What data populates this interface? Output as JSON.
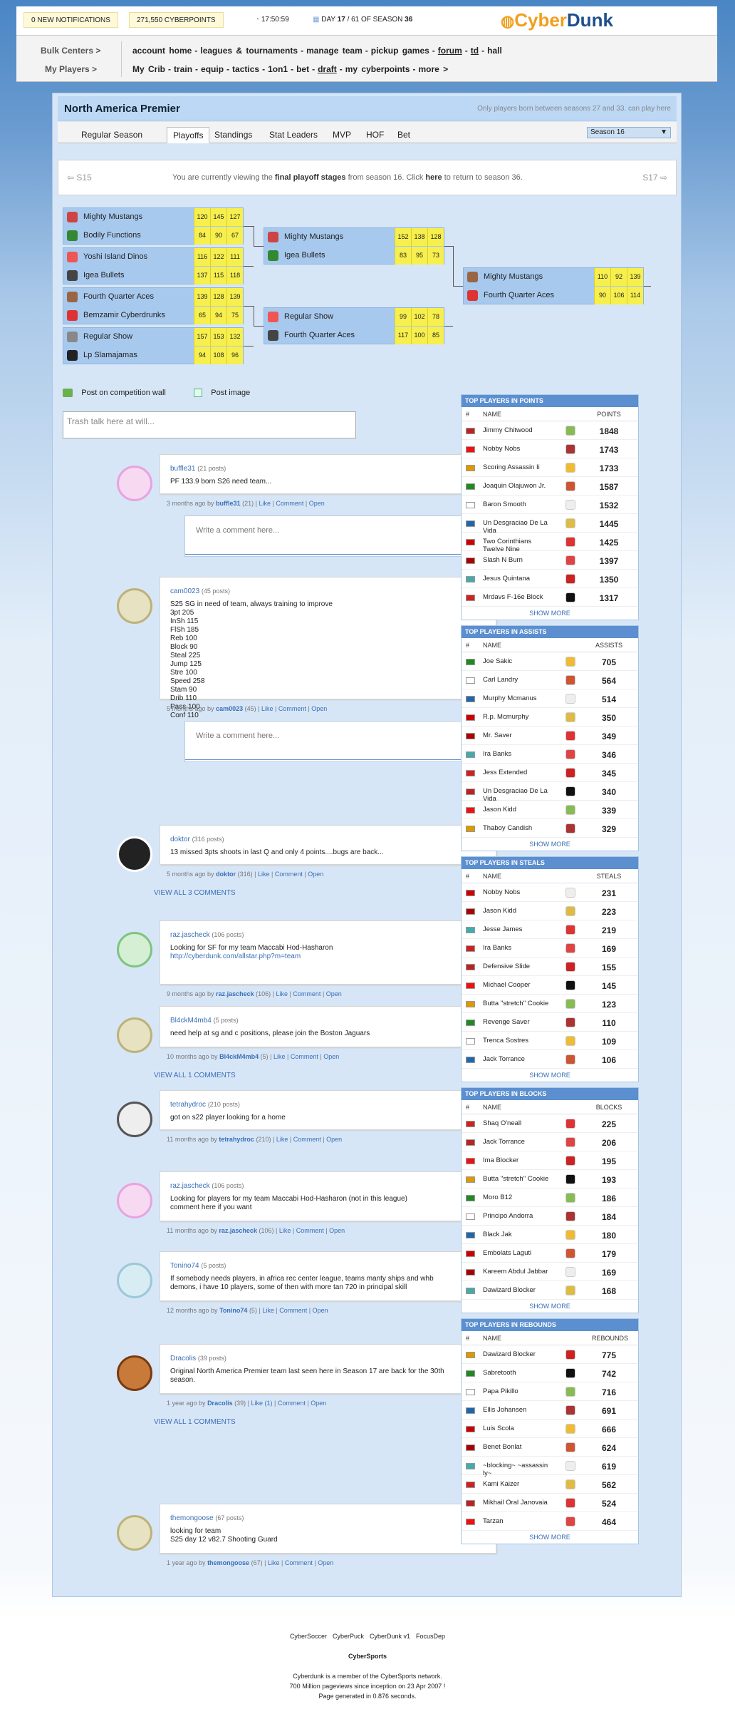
{
  "topbar": {
    "notifications": "0 NEW NOTIFICATIONS",
    "cyberpoints": "271,550 CYBERPOINTS",
    "time": "17:50:59",
    "season_prefix": "DAY",
    "day": "17",
    "day_of": "/ 61 OF SEASON",
    "season": "36",
    "logo_a": "Cyber",
    "logo_b": "Dunk"
  },
  "menu": {
    "left1": "Bulk Centers >",
    "left2": "My Players >",
    "row1": [
      "account home",
      "-",
      "leagues & tournaments",
      "-",
      "manage team",
      "-",
      "pickup games",
      "-",
      "forum",
      "-",
      "td",
      "-",
      "hall"
    ],
    "row2": [
      "My Crib",
      "-",
      "train",
      "-",
      "equip",
      "-",
      "tactics",
      "-",
      "1on1",
      "-",
      "bet",
      "-",
      "draft",
      "-",
      "my cyberpoints",
      "-",
      "more >"
    ]
  },
  "league": {
    "title": "North America Premier",
    "subtitle": "Only players born between seasons 27 and 33. can play here"
  },
  "tabs": [
    "Regular Season",
    "Playoffs",
    "Standings",
    "Stat Leaders",
    "MVP",
    "HOF",
    "Bet"
  ],
  "season_select": "Season 16",
  "nav": {
    "prev": "S15",
    "text_a": "You are currently viewing the ",
    "text_b": "final playoff stages",
    "text_c": " from season 16. Click ",
    "text_d": "here",
    "text_e": " to return to season 36.",
    "next": "S17"
  },
  "bracket": [
    {
      "t1": "Mighty Mustangs",
      "s1": [
        "120",
        "145",
        "127"
      ],
      "t2": "Bodily Functions",
      "s2": [
        "84",
        "90",
        "67"
      ]
    },
    {
      "t1": "Yoshi Island Dinos",
      "s1": [
        "116",
        "122",
        "111"
      ],
      "t2": "Igea Bullets",
      "s2": [
        "137",
        "115",
        "118"
      ]
    },
    {
      "t1": "Fourth Quarter Aces",
      "s1": [
        "139",
        "128",
        "139"
      ],
      "t2": "Bemzamir Cyberdrunks",
      "s2": [
        "65",
        "94",
        "75"
      ]
    },
    {
      "t1": "Regular Show",
      "s1": [
        "157",
        "153",
        "132"
      ],
      "t2": "Lp Slamajamas",
      "s2": [
        "94",
        "108",
        "96"
      ]
    },
    {
      "t1": "Mighty Mustangs",
      "s1": [
        "152",
        "138",
        "128"
      ],
      "t2": "Igea Bullets",
      "s2": [
        "83",
        "95",
        "73"
      ]
    },
    {
      "t1": "Regular Show",
      "s1": [
        "99",
        "102",
        "78"
      ],
      "t2": "Fourth Quarter Aces",
      "s2": [
        "117",
        "100",
        "85"
      ]
    },
    {
      "t1": "Mighty Mustangs",
      "s1": [
        "110",
        "92",
        "139"
      ],
      "t2": "Fourth Quarter Aces",
      "s2": [
        "90",
        "106",
        "114"
      ]
    }
  ],
  "wall": {
    "post_label": "Post on competition wall",
    "image_label": "Post image",
    "placeholder": "Trash talk here at will...",
    "comment_placeholder": "Write a comment here..."
  },
  "posts": [
    {
      "user": "buffle31",
      "count": "(21 posts)",
      "text": "PF 133.9 born S26 need team...",
      "meta_time": "3 months ago by",
      "meta_n": "(21)"
    },
    {
      "user": "cam0023",
      "count": "(45 posts)",
      "text": "S25 SG in need of team, always training to improve\n3pt 205\nInSh 115\nFlSh 185\nReb 100\nBlock 90\nSteal 225\nJump 125\nStre 100\nSpeed 258\nStam 90\nDrib 110\nPass 100\nConf 110",
      "meta_time": "5 months ago by",
      "meta_n": "(45)"
    },
    {
      "user": "doktor",
      "count": "(316 posts)",
      "text": "13 missed 3pts shoots in last Q and only 4 points....bugs are back...",
      "meta_time": "5 months ago by",
      "meta_n": "(316)"
    },
    {
      "user": "raz.jascheck",
      "count": "(106 posts)",
      "text": "Looking for SF for my team Maccabi Hod-Hasharon",
      "link": "http://cyberdunk.com/allstar.php?m=team",
      "meta_time": "9 months ago by",
      "meta_n": "(106)"
    },
    {
      "user": "Bl4ckM4mb4",
      "count": "(5 posts)",
      "text": "need help at sg and c positions, please join the Boston Jaguars",
      "meta_time": "10 months ago by",
      "meta_n": "(5)"
    },
    {
      "user": "tetrahydroc",
      "count": "(210 posts)",
      "text": "got on s22 player looking for a home",
      "meta_time": "11 months ago by",
      "meta_n": "(210)"
    },
    {
      "user": "raz.jascheck",
      "count": "(106 posts)",
      "text": "Looking for players for my team Maccabi Hod-Hasharon (not in this league)\ncomment here if you want",
      "meta_time": "11 months ago by",
      "meta_n": "(106)"
    },
    {
      "user": "Tonino74",
      "count": "(5 posts)",
      "text": "If somebody needs players, in africa rec center league, teams manty ships and whb\ndemons, i have 10 players, some of then with more tan 720 in principal skill",
      "meta_time": "12 months ago by",
      "meta_n": "(5)"
    },
    {
      "user": "Dracolis",
      "count": "(39 posts)",
      "text": "Original North America Premier team last seen here in Season 17 are back for the 30th\nseason.",
      "meta_time": "1 year ago by",
      "meta_n": "(39)",
      "like": "Like (1)"
    },
    {
      "user": "themongoose",
      "count": "(67 posts)",
      "text": "looking for team\nS25 day 12 v82.7 Shooting Guard",
      "meta_time": "1 year ago by",
      "meta_n": "(67)"
    }
  ],
  "actions": {
    "like": "Like",
    "comment": "Comment",
    "open": "Open",
    "sep": "|"
  },
  "view_all": [
    "VIEW ALL 3 COMMENTS",
    "VIEW ALL 1 COMMENTS",
    "VIEW ALL 1 COMMENTS"
  ],
  "stats": [
    {
      "title": "TOP PLAYERS IN POINTS",
      "col": "POINTS",
      "more": "SHOW MORE",
      "rows": [
        [
          "Jimmy Chitwood",
          "1848"
        ],
        [
          "Nobby Nobs",
          "1743"
        ],
        [
          "Scoring Assassin Ii",
          "1733"
        ],
        [
          "Joaquin Olajuwon Jr.",
          "1587"
        ],
        [
          "Baron Smooth",
          "1532"
        ],
        [
          "Un Desgraciao De La Vida",
          "1445"
        ],
        [
          "Two Corinthians Twelve Nine",
          "1425"
        ],
        [
          "Slash N Burn",
          "1397"
        ],
        [
          "Jesus Quintana",
          "1350"
        ],
        [
          "Mrdavs F-16e Block",
          "1317"
        ]
      ]
    },
    {
      "title": "TOP PLAYERS IN ASSISTS",
      "col": "ASSISTS",
      "more": "SHOW MORE",
      "rows": [
        [
          "Joe Sakic",
          "705"
        ],
        [
          "Carl Landry",
          "564"
        ],
        [
          "Murphy Mcmanus",
          "514"
        ],
        [
          "R.p. Mcmurphy",
          "350"
        ],
        [
          "Mr. Saver",
          "349"
        ],
        [
          "Ira Banks",
          "346"
        ],
        [
          "Jess Extended",
          "345"
        ],
        [
          "Un Desgraciao De La Vida",
          "340"
        ],
        [
          "Jason Kidd",
          "339"
        ],
        [
          "Thaboy Candish",
          "329"
        ]
      ]
    },
    {
      "title": "TOP PLAYERS IN STEALS",
      "col": "STEALS",
      "more": "SHOW MORE",
      "rows": [
        [
          "Nobby Nobs",
          "231"
        ],
        [
          "Jason Kidd",
          "223"
        ],
        [
          "Jesse James",
          "219"
        ],
        [
          "Ira Banks",
          "169"
        ],
        [
          "Defensive Slide",
          "155"
        ],
        [
          "Michael Cooper",
          "145"
        ],
        [
          "Butta \"stretch\" Cookie",
          "123"
        ],
        [
          "Revenge Saver",
          "110"
        ],
        [
          "Trenca Sostres",
          "109"
        ],
        [
          "Jack Torrance",
          "106"
        ]
      ]
    },
    {
      "title": "TOP PLAYERS IN BLOCKS",
      "col": "BLOCKS",
      "more": "SHOW MORE",
      "rows": [
        [
          "Shaq O'neall",
          "225"
        ],
        [
          "Jack Torrance",
          "206"
        ],
        [
          "Ima Blocker",
          "195"
        ],
        [
          "Butta \"stretch\" Cookie",
          "193"
        ],
        [
          "Moro B12",
          "186"
        ],
        [
          "Principo Andorra",
          "184"
        ],
        [
          "Black Jak",
          "180"
        ],
        [
          "Embolats Laguti",
          "179"
        ],
        [
          "Kareem Abdul Jabbar",
          "169"
        ],
        [
          "Dawizard Blocker",
          "168"
        ]
      ]
    },
    {
      "title": "TOP PLAYERS IN REBOUNDS",
      "col": "REBOUNDS",
      "more": "SHOW MORE",
      "rows": [
        [
          "Dawizard Blocker",
          "775"
        ],
        [
          "Sabretooth",
          "742"
        ],
        [
          "Papa Pikillo",
          "716"
        ],
        [
          "Ellis Johansen",
          "691"
        ],
        [
          "Luis Scola",
          "666"
        ],
        [
          "Benet Bonlat",
          "624"
        ],
        [
          "~blocking~ ~assassin ly~",
          "619"
        ],
        [
          "Kami Kaizer",
          "562"
        ],
        [
          "Mikhail Oral Janovaia",
          "524"
        ],
        [
          "Tarzan",
          "464"
        ]
      ]
    }
  ],
  "stats_hash": "#",
  "stats_name": "NAME",
  "footer": {
    "links": [
      "CyberSoccer",
      "CyberPuck",
      "CyberDunk v1",
      "FocusDep"
    ],
    "brand": "CyberSports",
    "l1": "Cyberdunk is a member of the CyberSports network.",
    "l2": "700 Million pageviews since inception on 23 Apr 2007 !",
    "l3": "Page generated in 0.876 seconds."
  },
  "colors": {
    "accent": "#3a6fb5",
    "score_bg": "#f6ef4d",
    "match_bg": "#a8c9ee",
    "header": "#5b8fcf"
  }
}
